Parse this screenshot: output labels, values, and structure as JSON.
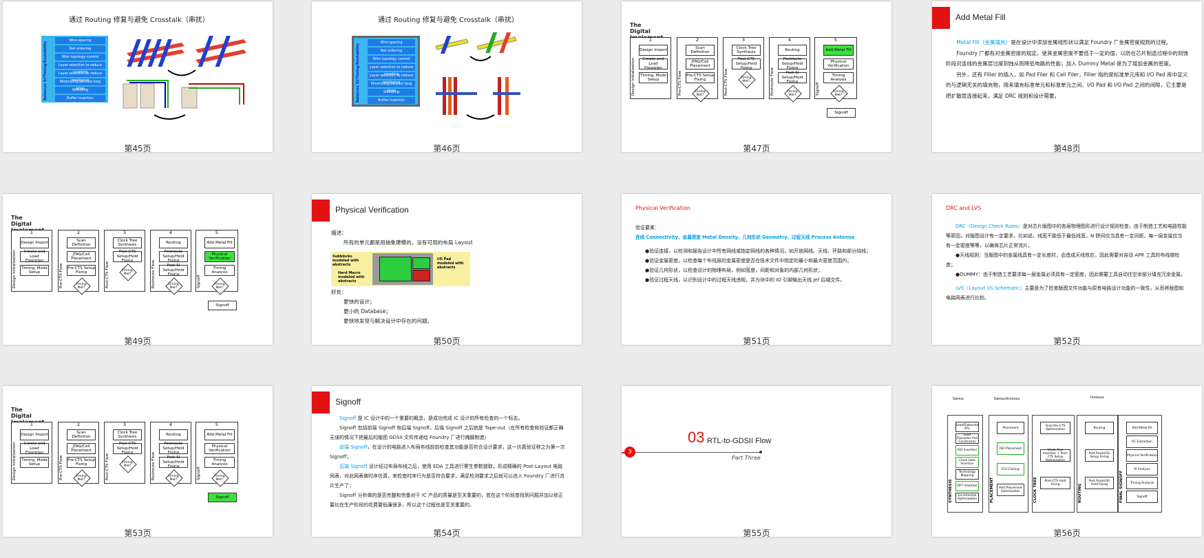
{
  "pages": [
    {
      "caption": "第45页",
      "title": "通过 Routing 修复与避免 Crosstalk（串扰）",
      "side_label": "Balances SI/Timing/Routability",
      "items": [
        "Wire-spacing",
        "Net ordering",
        "Wire topology control",
        "Layer selection to reduce coupling",
        "Layer selection to reduce resistance",
        "Minimizing parallel long wires",
        "Shielding",
        "Buffer insertion"
      ]
    },
    {
      "caption": "第46页",
      "title": "通过 Routing 修复与避免 Crosstalk（串扰）",
      "side_label": "Balances SI/Timing/Routability",
      "items": [
        "Wire spacing",
        "Net ordering",
        "Wire topology control",
        "Layer selection to reduce coupling",
        "Layer selection to reduce resistance",
        "Minimizing parallel long wires",
        "Shielding",
        "Buffer insertion"
      ]
    },
    {
      "caption": "第47页",
      "title": "The Digital Implement Flow"
    },
    {
      "caption": "第48页",
      "title": "Add Metal Fill",
      "paragraphs": [
        {
          "lead": "Metal Fill（金属填充）",
          "text": "是在设计中添加金属线形状以满足 Foundry 厂金属密度规则的过程。"
        },
        {
          "lead": "",
          "text": "Foundry 厂都有对金属密度的规定，使其金属密度不要低于一定的值，以防在芯片制造过程中的刻蚀阶段对连线的金属层过度刻蚀从而降低电路的性能；加入 Dummy Metal 是为了增加金属的密度。"
        },
        {
          "lead": "",
          "text": "另外，还有 Filler 的插入，如 Pad Filer 和 Cell Filer，Filler 指的是标准单元库和 I/O Pad 库中定义的与逻辑无关的填充物，用来填充标准单元和标准单元之间、I/O Pad 和 I/O Pad 之间的间隙，它主要是把扩散层连接起来，满足 DRC 规则和设计需要。"
        }
      ]
    },
    {
      "caption": "第49页",
      "title": "The Digital Implement Flow"
    },
    {
      "caption": "第50页",
      "title": "Physical Verification",
      "desc_label": "描述：",
      "desc": "所有的单元都是用抽象建模的，没有可用的布局 Layout",
      "fig_left1": "Subblocks modeled with abstracts",
      "fig_left2": "Hard Macro modeled with abstracts",
      "fig_right": "I/O Pad modeled with abstracts",
      "benefit_label": "好处：",
      "benefits": [
        "更快的设计；",
        "更小的 Database；",
        "更快地发现与解决设计中存在的问题。"
      ]
    },
    {
      "caption": "第51页",
      "title": "Physical Verification",
      "req_label": "验证要素：",
      "req_line": "连线 Connectivity、金属密度 Metal Density、几何形状 Geometry、过程天线 Process Antenna",
      "bullets": [
        "●验证连接，以检测和报告设计中所有网线或指定网线的各种情况，如开放网线、天线、环路和部分绕线；",
        "●验证金属密度，以检查每个布线层的金属密度是否在技术文件中指定的最小和最大密度范围内；",
        "●验证几何形状，以检查设计的物理布局，例如宽度，间距和对象的内部几何形状；",
        "●验证过程天线，以识别设计中的过程天线违规，并为块中的 IO 引脚输出天线 Jef 后缀文件。"
      ]
    },
    {
      "caption": "第52页",
      "title": "DRC and LVS",
      "drc_lead": "DRC（Design Check Rules）",
      "drc_text": "是对芯片版图中的各层物理图形进行设计规则检查，由于制造工艺和电路性能等原因，对版图设计有一定要求，比如说，线宽不能低于最低线宽，N 阱间应当具有一定间距，每一层金属应当有一定密度等等，以确保芯片正常流片。",
      "b1": "●天线规则：当版图中的金属线具有一定长度时，会造成天线效应，因此需要对自动 APR 工具的布线做检查；",
      "b2": "●DUMMY：由于制造工艺要求每一层金属必须具有一定密度，因此需要工具自动往空余部分填充冗余金属。",
      "lvs_lead": "LVS（Layout VS Schematic）",
      "lvs_text": "主要是为了检查版图文件功能与原有电路设计功能的一致性，从而将版图和电路网表进行比较。"
    },
    {
      "caption": "第53页",
      "title": "The Digital Implement Flow"
    },
    {
      "caption": "第54页",
      "title": "Signoff",
      "paras": [
        {
          "lead": "Signoff",
          "text": " 是 IC 设计中的一个重要的概念，是成功完成 IC 设计的所有检查的一个标志。"
        },
        {
          "lead": "",
          "text": "Signoff 包括前端 Signoff 和后端 Signoff。后端 Signoff 之后就是 Tape-out（在所有检查和验证都正确无误的情况下把最后的版图 GDSII 文件传递给 Foundry 厂进行掩膜制造）"
        },
        {
          "lead": "前端 Signoff",
          "text": "，在设计的电路进入布局布线前前检查其功能是否符合设计要求，这一仿真验证称之为第一次 Signoff；"
        },
        {
          "lead": "后端 Signoff",
          "text": " 设计经过布局布线之后，使用 EDA 工具进行寄生参数提取，形成精确的 Post-Layout 电路网表，对此网表做时序仿真，来检查时序行为是否符合要求，满足检测要求之后就可以进入 Foundry 厂进行流片生产了；"
        },
        {
          "lead": "",
          "text": "Signoff 分析做的是否完整和完备对于 IC 产品的质量是至关重要的，若在这个阶段查找到问题并加以修正要比在生产阶段的花费要低廉很多，所以这个过程也是至关重要的。"
        }
      ]
    },
    {
      "caption": "第55页",
      "num": "03",
      "title": "RTL-to-GDSII Flow",
      "sub": "Part Three",
      "badge": "3"
    },
    {
      "caption": "第56页"
    }
  ],
  "flow": {
    "columns": [
      {
        "n": "1",
        "side": "Design Initialization",
        "boxes": [
          "Design Import",
          "Create and Load Floorplan",
          "Timing, Mode Setup"
        ]
      },
      {
        "n": "2",
        "side": "Pre-CTS Flow",
        "boxes": [
          "Scan Definition",
          "JTAG/Cell Placement",
          "Pre-CTS Setup Fixing"
        ],
        "dia": "Timing Met?"
      },
      {
        "n": "3",
        "side": "Post-CTS Flow",
        "boxes": [
          "Clock Tree Synthesis",
          "Post-CTS Setup/Hold Fixing"
        ],
        "dia": "Timing Met?"
      },
      {
        "n": "4",
        "side": "Postroute Flow",
        "boxes": [
          "Routing",
          "Postroute Setup/Hold Fixing",
          "Post-SI Setup/Hold Fixing"
        ],
        "dia": "Timing Met?"
      },
      {
        "n": "5",
        "side": "Signoff",
        "boxes": [
          "Add Metal Fill",
          "Physical Verification",
          "Timing Analysis"
        ],
        "dia": "Timing Met?"
      }
    ],
    "end": "Signoff",
    "green_p47": "Add Metal Fill",
    "green_p49": "Physical Verification",
    "green_p53": "Signoff"
  },
  "p56": {
    "headers": [
      "Genus",
      "Genus/Innovus",
      "Innovus"
    ],
    "col_labels": [
      "SYNTHESIS",
      "PLACEMENT",
      "CLOCK TREE",
      "ROUTING",
      "FINAL SIGNOFF"
    ],
    "syn": [
      "Load/Elaborate RTL",
      "Load Floorplan And Constraints",
      "ISO Insertion",
      "Clock Gate Insertion",
      "Technology Mapping",
      "DFT Insertion",
      "Incremental Optimization"
    ],
    "place": [
      "Placement",
      "ISO Placement",
      "ICG Cloning",
      "Post Placement Optimization"
    ],
    "clock": [
      "Final Pre-CTS Optimization",
      "Clock Tree Insertion + Post-CTS Setup Optimization",
      "Post-CTS Hold Fixing"
    ],
    "route": [
      "Routing",
      "Post Route(SI) Setup Fixing",
      "Post Route(SI) Hold Fixing"
    ],
    "final": [
      "Add Metal Fill",
      "RC Extraction",
      "Physical Verification",
      "SI Analysis",
      "Timing Analysis",
      "Signoff"
    ]
  }
}
